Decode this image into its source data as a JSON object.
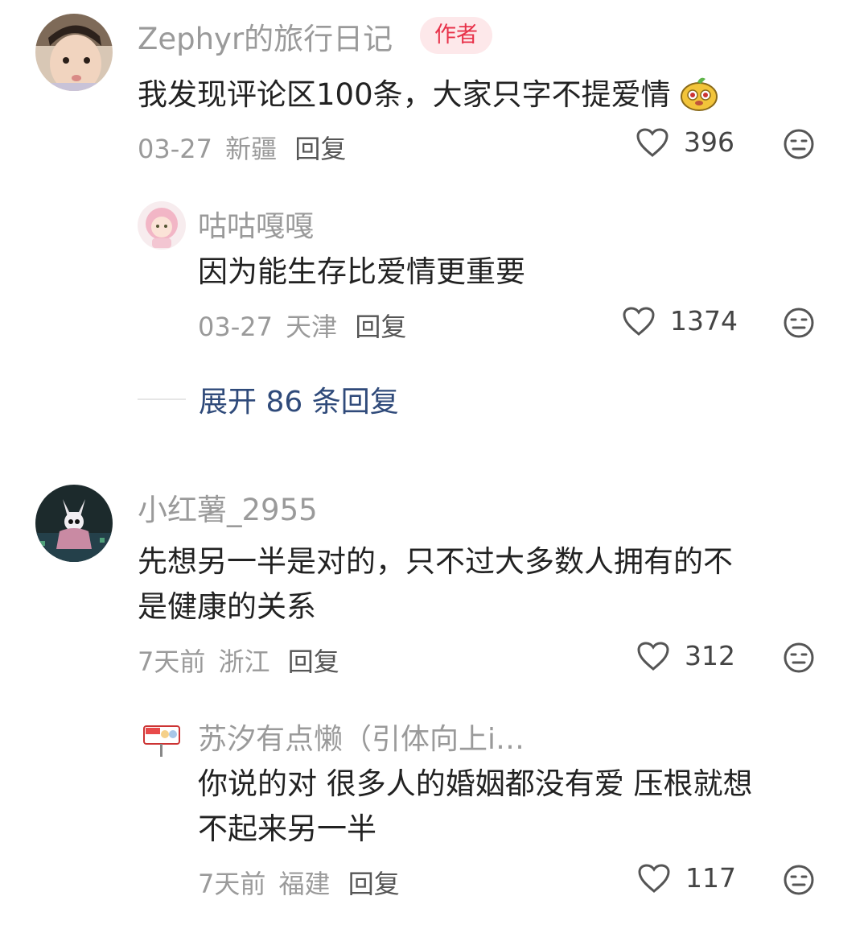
{
  "comments": [
    {
      "name": "Zephyr的旅行日记",
      "badge": "作者",
      "text": "我发现评论区100条，大家只字不提爱情",
      "date": "03-27",
      "location": "新疆",
      "reply_label": "回复",
      "likes": "396",
      "avatar_icon": "child-photo-avatar",
      "replies": [
        {
          "name": "咕咕嘎嘎",
          "text": "因为能生存比爱情更重要",
          "date": "03-27",
          "location": "天津",
          "reply_label": "回复",
          "likes": "1374",
          "avatar_icon": "pink-doll-avatar"
        }
      ],
      "expand_label": "展开 86 条回复"
    },
    {
      "name": "小红薯_2955",
      "text_line1": "先想另一半是对的，只不过大多数人拥有的不",
      "text_line2": "是健康的关系",
      "date": "7天前",
      "location": "浙江",
      "reply_label": "回复",
      "likes": "312",
      "avatar_icon": "pixel-knight-avatar",
      "replies": [
        {
          "name": "苏汐有点懒（引体向上i…",
          "text_line1": "你说的对 很多人的婚姻都没有爱 压根就想",
          "text_line2": "不起来另一半",
          "date": "7天前",
          "location": "福建",
          "reply_label": "回复",
          "likes": "117",
          "avatar_icon": "cartoon-sign-avatar"
        }
      ]
    }
  ],
  "colors": {
    "badge_bg": "#fde8ea",
    "badge_text": "#e8324a",
    "link": "#2f4a7a"
  }
}
